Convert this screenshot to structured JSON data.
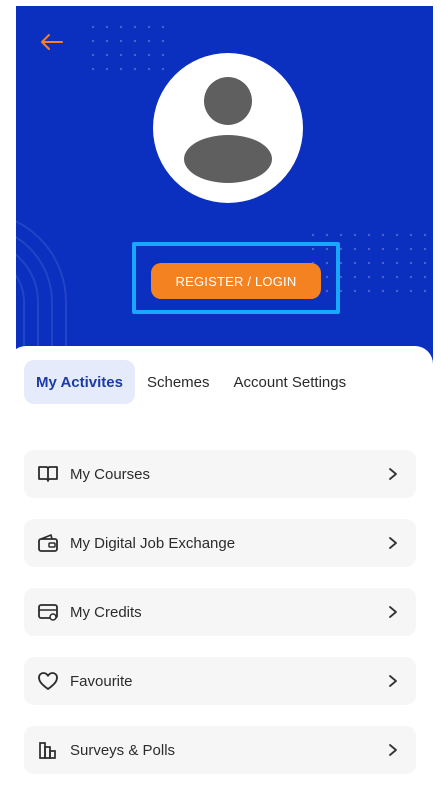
{
  "header": {
    "login_button_label": "REGISTER / LOGIN"
  },
  "icons": {
    "back": "arrow-left-icon",
    "avatar": "user-avatar-icon",
    "chevron": "chevron-right-icon"
  },
  "colors": {
    "hero_bg": "#0b2fbf",
    "accent_orange": "#f58220",
    "highlight": "#17a7ff",
    "active_tab_bg": "#e6ebfb",
    "active_tab_text": "#1b3ba8"
  },
  "tabs": [
    {
      "label": "My Activites",
      "active": true
    },
    {
      "label": "Schemes",
      "active": false
    },
    {
      "label": "Account Settings",
      "active": false
    }
  ],
  "menu": [
    {
      "label": "My Courses",
      "icon": "book-icon"
    },
    {
      "label": "My Digital Job Exchange",
      "icon": "wallet-icon"
    },
    {
      "label": "My Credits",
      "icon": "credit-card-icon"
    },
    {
      "label": "Favourite",
      "icon": "heart-icon"
    },
    {
      "label": "Surveys & Polls",
      "icon": "survey-chart-icon"
    }
  ]
}
